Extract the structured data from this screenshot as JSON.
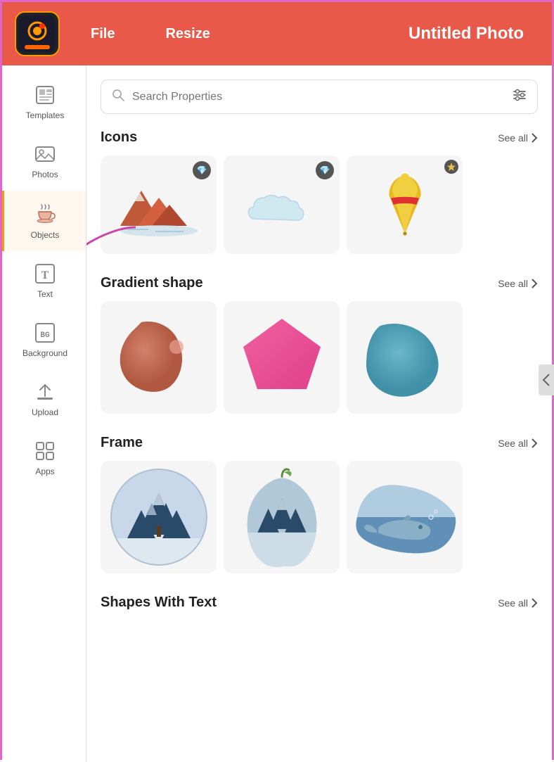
{
  "topbar": {
    "file_label": "File",
    "resize_label": "Resize",
    "title": "Untitled Photo"
  },
  "sidebar": {
    "items": [
      {
        "id": "templates",
        "label": "Templates",
        "icon": "templates"
      },
      {
        "id": "photos",
        "label": "Photos",
        "icon": "photos"
      },
      {
        "id": "objects",
        "label": "Objects",
        "icon": "objects",
        "active": true
      },
      {
        "id": "text",
        "label": "Text",
        "icon": "text"
      },
      {
        "id": "background",
        "label": "Background",
        "icon": "background"
      },
      {
        "id": "upload",
        "label": "Upload",
        "icon": "upload"
      },
      {
        "id": "apps",
        "label": "Apps",
        "icon": "apps"
      }
    ]
  },
  "search": {
    "placeholder": "Search Properties"
  },
  "sections": {
    "icons": {
      "title": "Icons",
      "see_all": "See all"
    },
    "gradient_shape": {
      "title": "Gradient shape",
      "see_all": "See all"
    },
    "frame": {
      "title": "Frame",
      "see_all": "See all"
    },
    "shapes_with_text": {
      "title": "Shapes With Text",
      "see_all": "See all"
    }
  },
  "colors": {
    "topbar": "#e8594a",
    "active_border": "#f0a000",
    "accent": "#e8594a"
  }
}
